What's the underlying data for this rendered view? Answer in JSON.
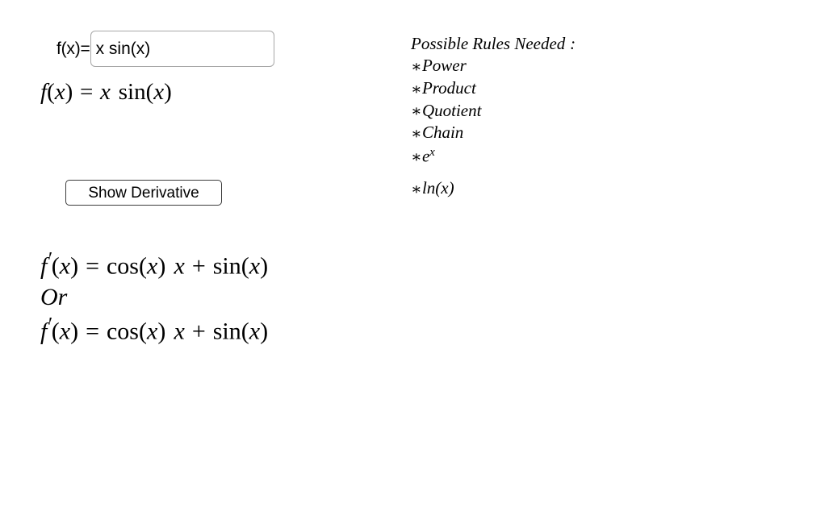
{
  "page": {
    "background": "#ffffff",
    "text_color": "#000000"
  },
  "input_section": {
    "label": "f(x)=",
    "value": "x sin(x)",
    "placeholder": "",
    "border_color": "#a7a7a7"
  },
  "function_display": {
    "fname": "f",
    "open": "(",
    "var": "x",
    "close": ")",
    "equals": "=",
    "term_var": "x",
    "func_name": "sin",
    "func_open": "(",
    "func_var": "x",
    "func_close": ")",
    "plain_text": "f(x) = x sin(x)"
  },
  "button": {
    "label": "Show Derivative",
    "border_color": "#3c3c3c",
    "fill_color": "#ffffff"
  },
  "derivative": {
    "or_label": "Or",
    "line1": {
      "fname": "f",
      "prime": "′",
      "open": "(",
      "var": "x",
      "close": ")",
      "equals": "=",
      "t1_func": "cos",
      "t1_open": "(",
      "t1_var": "x",
      "t1_close": ")",
      "t1_mult_var": "x",
      "plus": "+",
      "t2_func": "sin",
      "t2_open": "(",
      "t2_var": "x",
      "t2_close": ")",
      "plain_text": "f'(x) = cos(x) x + sin(x)"
    },
    "line2": {
      "fname": "f",
      "prime": "′",
      "open": "(",
      "var": "x",
      "close": ")",
      "equals": "=",
      "t1_func": "cos",
      "t1_open": "(",
      "t1_var": "x",
      "t1_close": ")",
      "t1_mult_var": "x",
      "plus": "+",
      "t2_func": "sin",
      "t2_open": "(",
      "t2_var": "x",
      "t2_close": ")",
      "plain_text": "f'(x) = cos(x) x + sin(x)"
    }
  },
  "rules_panel": {
    "heading_text": "Possible Rules Needed",
    "heading_colon": ":",
    "items": [
      {
        "star": "∗",
        "label": "Power",
        "sup": ""
      },
      {
        "star": "∗",
        "label": "Product",
        "sup": ""
      },
      {
        "star": "∗",
        "label": "Quotient",
        "sup": ""
      },
      {
        "star": "∗",
        "label": "Chain",
        "sup": ""
      },
      {
        "star": "∗",
        "label": "e",
        "sup": "x"
      },
      {
        "star": "∗",
        "label": "ln(x)",
        "sup": ""
      }
    ]
  }
}
